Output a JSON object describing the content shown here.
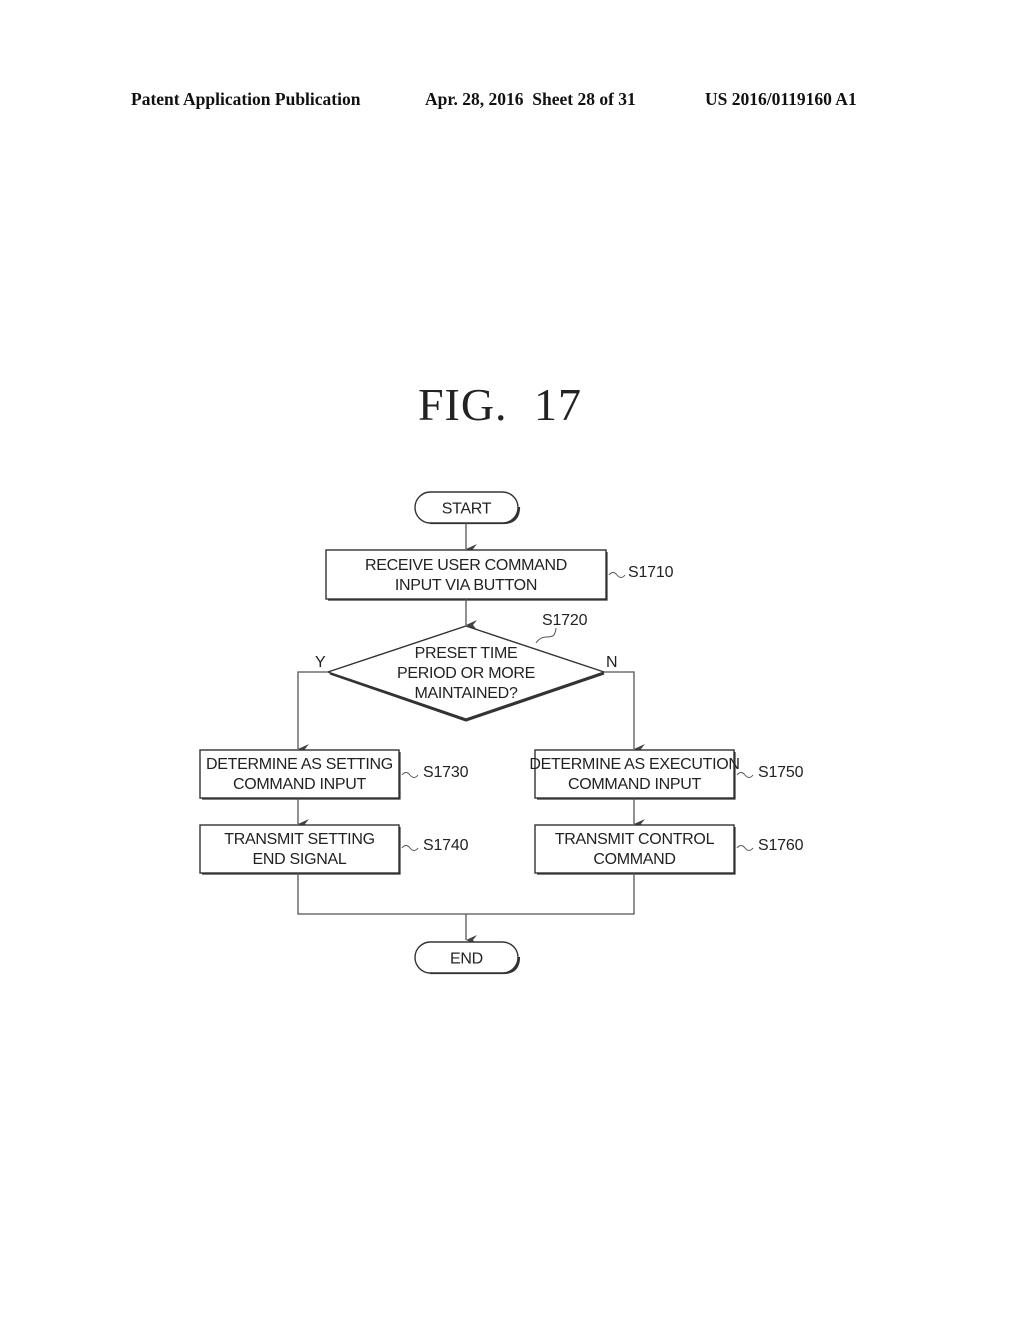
{
  "header": {
    "publication": "Patent Application Publication",
    "date_sheet": "Apr. 28, 2016  Sheet 28 of 31",
    "number": "US 2016/0119160 A1"
  },
  "figure": {
    "title": "FIG. 17"
  },
  "flowchart": {
    "start": "START",
    "end": "END",
    "steps": {
      "s1710": {
        "id": "S1710",
        "lines": [
          "RECEIVE USER COMMAND",
          "INPUT VIA BUTTON"
        ]
      },
      "s1720": {
        "id": "S1720",
        "lines": [
          "PRESET TIME",
          "PERIOD OR MORE",
          "MAINTAINED?"
        ],
        "yes_label": "Y",
        "no_label": "N"
      },
      "s1730": {
        "id": "S1730",
        "lines": [
          "DETERMINE AS SETTING",
          "COMMAND INPUT"
        ]
      },
      "s1740": {
        "id": "S1740",
        "lines": [
          "TRANSMIT SETTING",
          "END SIGNAL"
        ]
      },
      "s1750": {
        "id": "S1750",
        "lines": [
          "DETERMINE AS EXECUTION",
          "COMMAND INPUT"
        ]
      },
      "s1760": {
        "id": "S1760",
        "lines": [
          "TRANSMIT CONTROL",
          "COMMAND"
        ]
      }
    }
  }
}
